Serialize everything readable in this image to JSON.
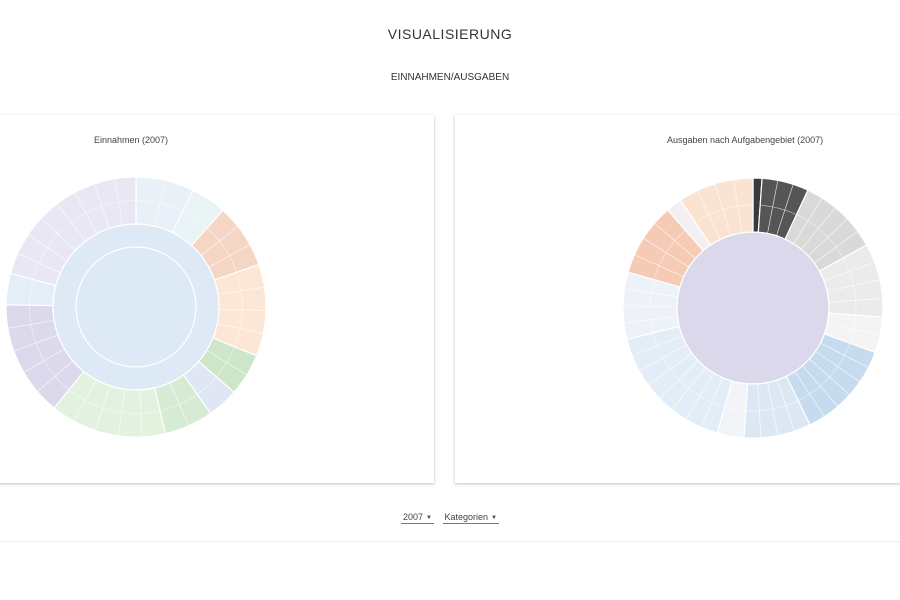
{
  "header": {
    "title": "VISUALISIERUNG",
    "subtitle": "EINNAHMEN/AUSGABEN"
  },
  "controls": {
    "year_value": "2007",
    "category_value": "Kategorien"
  },
  "chart_data": [
    {
      "type": "sunburst",
      "title": "Einnahmen (2007)",
      "rings": [
        {
          "level": 1,
          "segments": [
            {
              "value": 360,
              "color": "#c3d7ea"
            }
          ]
        },
        {
          "level": 2,
          "segments": [
            {
              "value": 360,
              "color": "#dde9f4"
            }
          ]
        },
        {
          "level": 3,
          "segments": [
            {
              "value": 26,
              "color": "#e9f0f7"
            },
            {
              "value": 16,
              "color": "#e8f4f5"
            },
            {
              "value": 29,
              "color": "#f5d6c5"
            },
            {
              "value": 41,
              "color": "#fce6d6"
            },
            {
              "value": 19,
              "color": "#cde6c9"
            },
            {
              "value": 14,
              "color": "#dfe7f4"
            },
            {
              "value": 22,
              "color": "#d6ebd3"
            },
            {
              "value": 52,
              "color": "#e3f1df"
            },
            {
              "value": 52,
              "color": "#ddd9ec"
            },
            {
              "value": 14,
              "color": "#e3eef7"
            },
            {
              "value": 75,
              "color": "#e8e7f3"
            }
          ]
        }
      ]
    },
    {
      "type": "sunburst",
      "title": "Ausgaben nach Aufgabengebiet (2007)",
      "rings": [
        {
          "level": 1,
          "segments": [
            {
              "value": 360,
              "color": "#dbd8ec"
            }
          ]
        },
        {
          "level": 2,
          "segments": [
            {
              "value": 4,
              "color": "#3a3a3a"
            },
            {
              "value": 21,
              "color": "#555555"
            },
            {
              "value": 36,
              "color": "#d9d9d9"
            },
            {
              "value": 33,
              "color": "#ebebeb"
            },
            {
              "value": 16,
              "color": "#f4f4f4"
            },
            {
              "value": 44,
              "color": "#c6dcee"
            },
            {
              "value": 30,
              "color": "#dbe8f4"
            },
            {
              "value": 12,
              "color": "#f3f4f8"
            },
            {
              "value": 60,
              "color": "#e2edf7"
            },
            {
              "value": 30,
              "color": "#edf2f9"
            },
            {
              "value": 33,
              "color": "#f6cbb5"
            },
            {
              "value": 7,
              "color": "#f3f0f3"
            },
            {
              "value": 34,
              "color": "#fbe3d1"
            }
          ]
        }
      ]
    }
  ]
}
